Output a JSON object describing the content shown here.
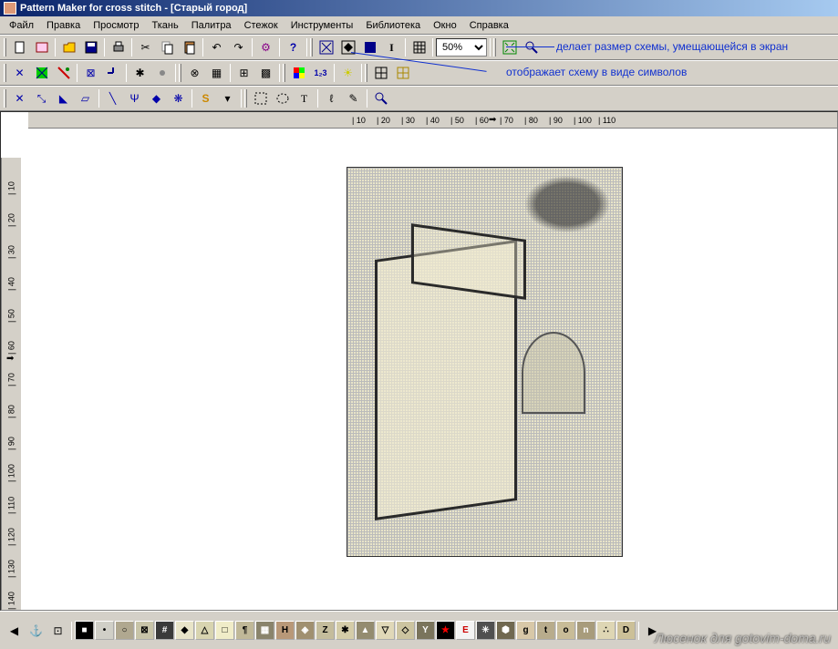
{
  "title": "Pattern Maker for cross stitch - [Старый город]",
  "menu": [
    "Файл",
    "Правка",
    "Просмотр",
    "Ткань",
    "Палитра",
    "Стежок",
    "Инструменты",
    "Библиотека",
    "Окно",
    "Справка"
  ],
  "zoom": "50%",
  "annotations": {
    "fit": "делает размер схемы, умещающейся в экран",
    "symbols": "отображает схему в виде символов"
  },
  "ruler_h": [
    "10",
    "20",
    "30",
    "40",
    "50",
    "60",
    "70",
    "80",
    "90",
    "100",
    "110"
  ],
  "ruler_v": [
    "10",
    "20",
    "30",
    "40",
    "50",
    "60",
    "70",
    "80",
    "90",
    "100",
    "110",
    "120",
    "130",
    "140"
  ],
  "palette": [
    {
      "bg": "#000",
      "fg": "#fff",
      "sym": "■"
    },
    {
      "bg": "#d0cfc7",
      "fg": "#000",
      "sym": "•"
    },
    {
      "bg": "#b0a890",
      "fg": "#000",
      "sym": "○"
    },
    {
      "bg": "#c8c4a8",
      "fg": "#000",
      "sym": "⊠"
    },
    {
      "bg": "#3a3a3a",
      "fg": "#fff",
      "sym": "#"
    },
    {
      "bg": "#e8e4c8",
      "fg": "#000",
      "sym": "◆"
    },
    {
      "bg": "#d8d4b0",
      "fg": "#000",
      "sym": "△"
    },
    {
      "bg": "#f0ecc8",
      "fg": "#000",
      "sym": "□"
    },
    {
      "bg": "#c0b898",
      "fg": "#000",
      "sym": "¶"
    },
    {
      "bg": "#8a846c",
      "fg": "#fff",
      "sym": "▦"
    },
    {
      "bg": "#b89878",
      "fg": "#000",
      "sym": "H"
    },
    {
      "bg": "#a09070",
      "fg": "#fff",
      "sym": "◈"
    },
    {
      "bg": "#c4bc9c",
      "fg": "#000",
      "sym": "Z"
    },
    {
      "bg": "#d4cca8",
      "fg": "#000",
      "sym": "✱"
    },
    {
      "bg": "#948c70",
      "fg": "#fff",
      "sym": "▲"
    },
    {
      "bg": "#e0d8b8",
      "fg": "#000",
      "sym": "▽"
    },
    {
      "bg": "#ccc4a0",
      "fg": "#000",
      "sym": "◇"
    },
    {
      "bg": "#7a745c",
      "fg": "#fff",
      "sym": "Y"
    },
    {
      "bg": "#000",
      "fg": "#f00",
      "sym": "★"
    },
    {
      "bg": "#f4f4f4",
      "fg": "#c00",
      "sym": "E"
    },
    {
      "bg": "#505050",
      "fg": "#fff",
      "sym": "✳"
    },
    {
      "bg": "#706850",
      "fg": "#fff",
      "sym": "⬢"
    },
    {
      "bg": "#d8c8a8",
      "fg": "#000",
      "sym": "g"
    },
    {
      "bg": "#b8ac8c",
      "fg": "#000",
      "sym": "t"
    },
    {
      "bg": "#c8bc98",
      "fg": "#000",
      "sym": "o"
    },
    {
      "bg": "#a89c7c",
      "fg": "#fff",
      "sym": "n"
    },
    {
      "bg": "#ded6b4",
      "fg": "#000",
      "sym": "∴"
    },
    {
      "bg": "#ccc098",
      "fg": "#000",
      "sym": "D"
    }
  ],
  "watermark": "Люсенок для gotovim-doma.ru"
}
